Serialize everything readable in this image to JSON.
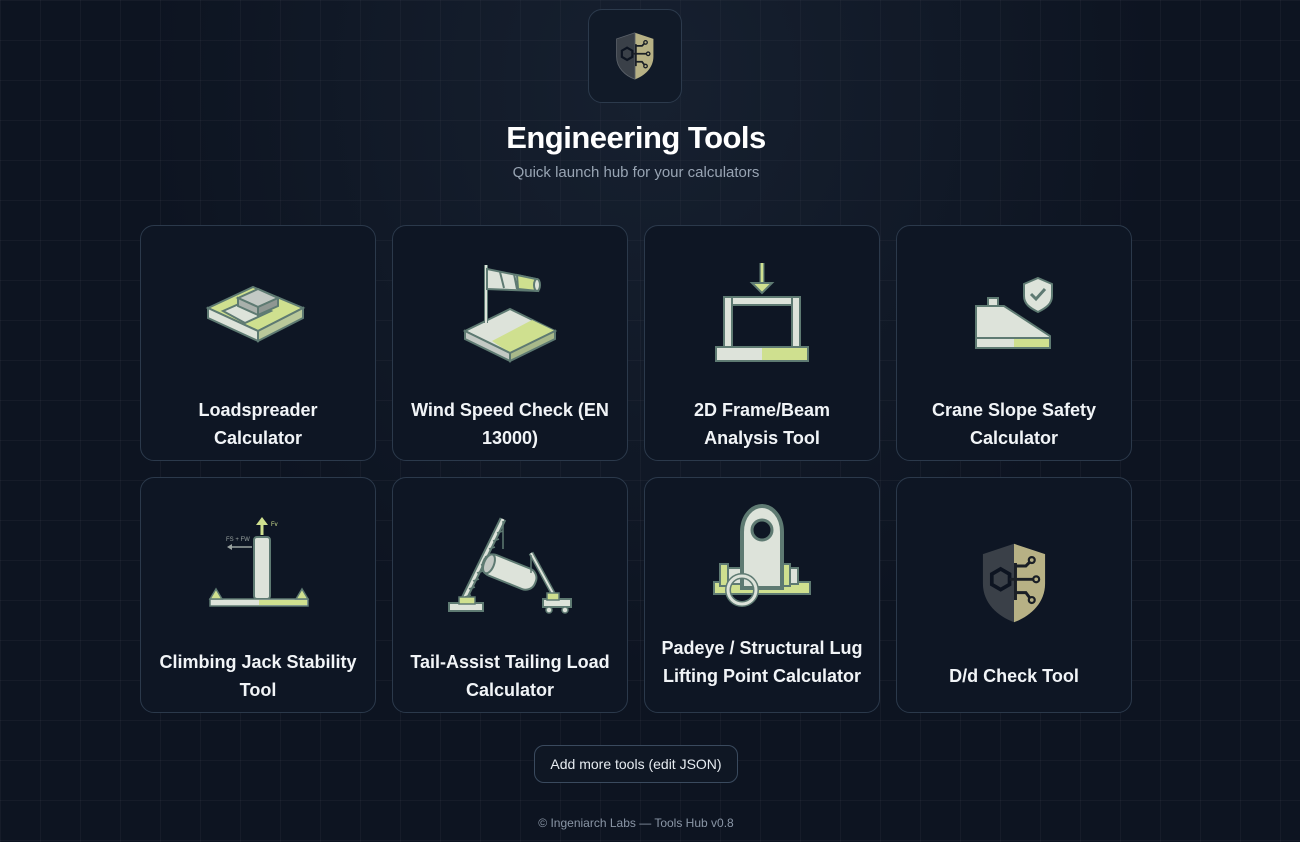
{
  "header": {
    "logo_icon": "shield-circuit-icon",
    "title": "Engineering Tools",
    "subtitle": "Quick launch hub for your calculators"
  },
  "tools": [
    {
      "label": "Loadspreader Calculator",
      "icon": "loadspreader-icon"
    },
    {
      "label": "Wind Speed Check (EN 13000)",
      "icon": "windsock-icon"
    },
    {
      "label": "2D Frame/Beam Analysis Tool",
      "icon": "frame-beam-icon"
    },
    {
      "label": "Crane Slope Safety Calculator",
      "icon": "crane-slope-icon"
    },
    {
      "label": "Climbing Jack Stability Tool",
      "icon": "climbing-jack-icon",
      "annotations": {
        "force_left": "FS + FW",
        "force_top": "Fv"
      }
    },
    {
      "label": "Tail-Assist Tailing Load Calculator",
      "icon": "tailing-cranes-icon"
    },
    {
      "label": "Padeye / Structural Lug Lifting Point Calculator",
      "icon": "padeye-icon"
    },
    {
      "label": "D/d Check Tool",
      "icon": "shield-circuit-icon"
    }
  ],
  "actions": {
    "add_more": "Add more tools (edit JSON)"
  },
  "footer": {
    "text": "© Ingeniarch Labs — Tools Hub v0.8"
  },
  "colors": {
    "background": "#0d1421",
    "card": "#0e1624",
    "card_border": "#2b394b",
    "accent_lime": "#cfe08f",
    "icon_light": "#dde3da",
    "icon_outline": "#5e7a72",
    "shield_khaki": "#b7b185"
  }
}
